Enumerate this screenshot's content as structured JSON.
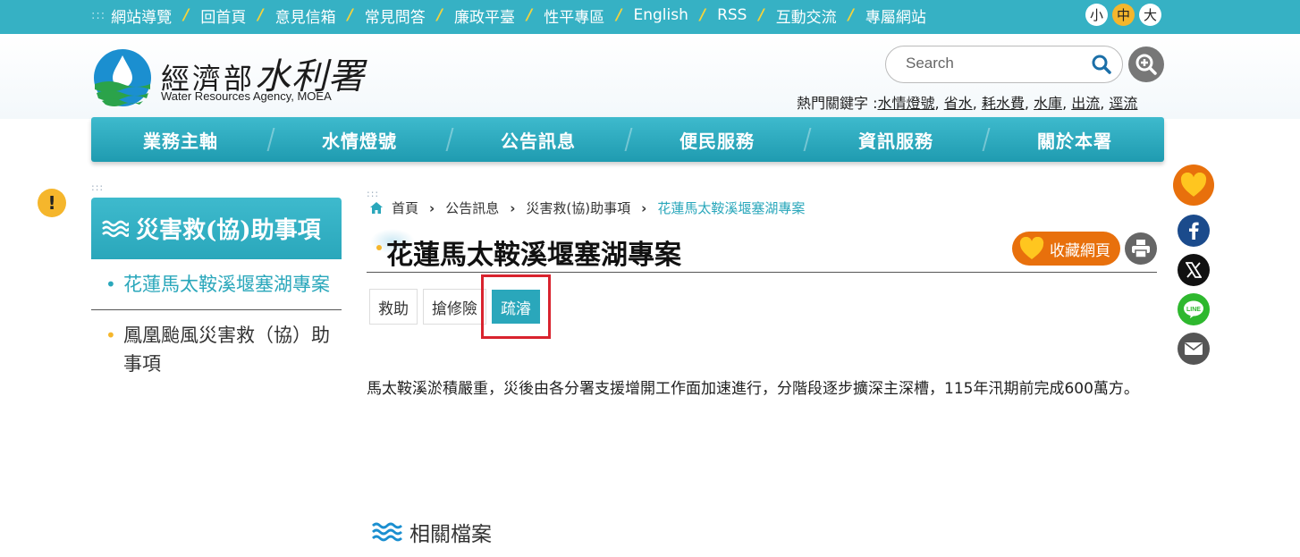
{
  "topnav": {
    "items": [
      "網站導覽",
      "回首頁",
      "意見信箱",
      "常見問答",
      "廉政平臺",
      "性平專區",
      "English",
      "RSS",
      "互動交流",
      "專屬網站"
    ],
    "fontsize": [
      "小",
      "中",
      "大"
    ]
  },
  "header": {
    "logo_cn_small": "經濟部",
    "logo_cn_big": "水利署",
    "logo_en": "Water Resources Agency, MOEA",
    "search_placeholder": "Search",
    "hotkeys_label": "熱門關鍵字 :",
    "hotkeys": [
      "水情燈號",
      "省水",
      "耗水費",
      "水庫",
      "出流",
      "逕流"
    ]
  },
  "mainnav": [
    "業務主軸",
    "水情燈號",
    "公告訊息",
    "便民服務",
    "資訊服務",
    "關於本署"
  ],
  "sidebar": {
    "notice_symbol": "!",
    "dots": ":::",
    "title": "災害救(協)助事項",
    "items": [
      "花蓮馬太鞍溪堰塞湖專案",
      "鳳凰颱風災害救（協）助事項"
    ]
  },
  "content": {
    "dots": ":::",
    "breadcrumb": [
      "首頁",
      "公告訊息",
      "災害救(協)助事項",
      "花蓮馬太鞍溪堰塞湖專案"
    ],
    "title": "花蓮馬太鞍溪堰塞湖專案",
    "fav_label": "收藏網頁",
    "tabs": [
      "救助",
      "搶修險",
      "疏濬"
    ],
    "body": "馬太鞍溪淤積嚴重，災後由各分署支援增開工作面加速進行，分階段逐步擴深主深槽，115年汛期前完成600萬方。",
    "related_title": "相關檔案"
  },
  "colors": {
    "teal": "#36b1c4",
    "gold": "#f5b62c",
    "orange": "#e8700c",
    "highlight": "#d9232e"
  }
}
